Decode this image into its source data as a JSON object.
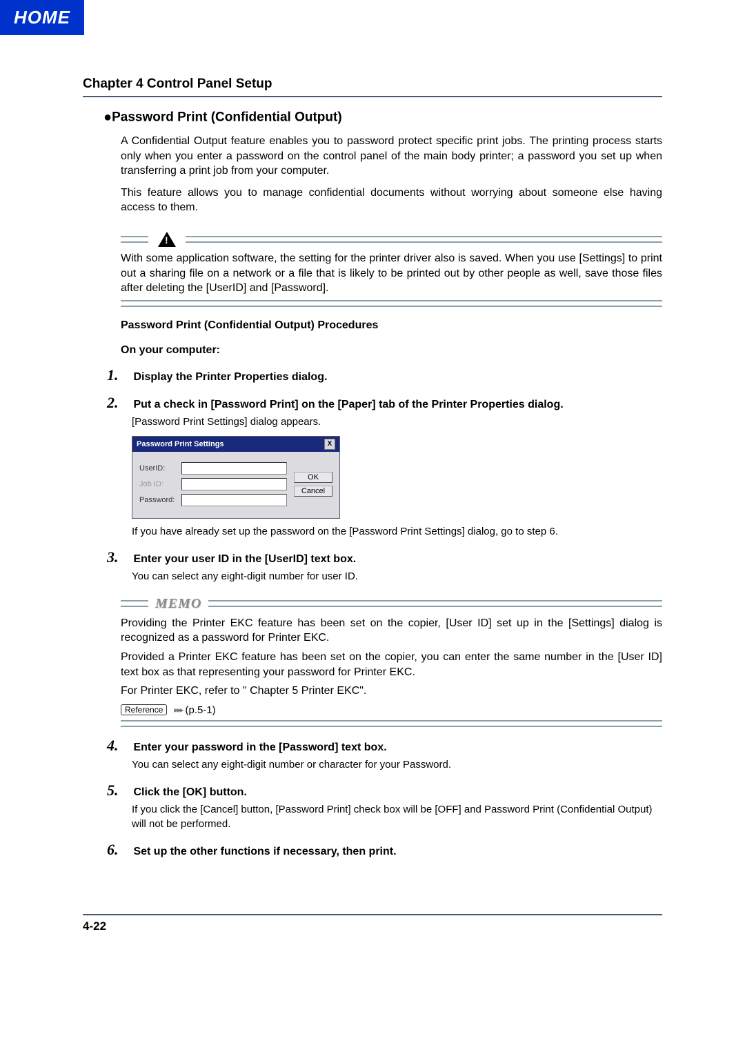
{
  "nav": {
    "home": "HOME"
  },
  "chapter": "Chapter 4 Control Panel Setup",
  "section": {
    "bullet": "●",
    "title": "Password Print (Confidential Output)"
  },
  "intro": {
    "p1": "A Confidential Output feature enables you to password protect specific print jobs. The printing process starts only when you enter a password on the control panel of the main body printer; a password you set up when transferring a print job from your computer.",
    "p2": "This feature allows you to manage confidential documents without worrying about someone else having access to them."
  },
  "caution": {
    "text": "With some application software, the setting for the printer driver also is saved. When you use [Settings] to print out a sharing file on a network or a file that is likely to be printed out by other people as well, save those files after deleting the [UserID] and [Password]."
  },
  "procedures": {
    "title": "Password Print (Confidential Output) Procedures",
    "subtitle": "On your computer:",
    "steps": [
      {
        "bold": "Display the Printer Properties dialog."
      },
      {
        "bold": "Put a check in [Password Print] on the [Paper] tab of the Printer Properties dialog.",
        "sub1": "[Password Print Settings] dialog appears.",
        "sub2": "If you have already set up the password on the [Password Print Settings] dialog, go to step 6."
      },
      {
        "bold": "Enter your user ID in the [UserID] text box.",
        "sub1": "You can select any eight-digit number for user ID."
      },
      {
        "bold": "Enter your password in the [Password] text box.",
        "sub1": "You can select any eight-digit number or character for your Password."
      },
      {
        "bold": "Click the [OK] button.",
        "sub1": "If you click the [Cancel] button, [Password Print] check box will be [OFF] and Password Print (Confidential Output) will not be performed."
      },
      {
        "bold": "Set up the other functions if necessary, then print."
      }
    ]
  },
  "dialog": {
    "title": "Password Print Settings",
    "labels": {
      "userid": "UserID:",
      "jobid": "Job ID:",
      "password": "Password:"
    },
    "buttons": {
      "ok": "OK",
      "cancel": "Cancel"
    }
  },
  "memo": {
    "label": "MEMO",
    "p1": "Providing the Printer EKC feature has been set on the copier, [User ID] set up in the [Settings] dialog is recognized as a password for Printer EKC.",
    "p2": "Provided a Printer EKC feature has been set on the copier, you can enter the same number in the [User ID] text box as that representing your password for Printer EKC.",
    "p3": "For Printer EKC, refer to \" Chapter 5 Printer EKC\"."
  },
  "reference": {
    "tag": "Reference",
    "page": "(p.5-1)"
  },
  "footer": {
    "page": "4-22"
  }
}
